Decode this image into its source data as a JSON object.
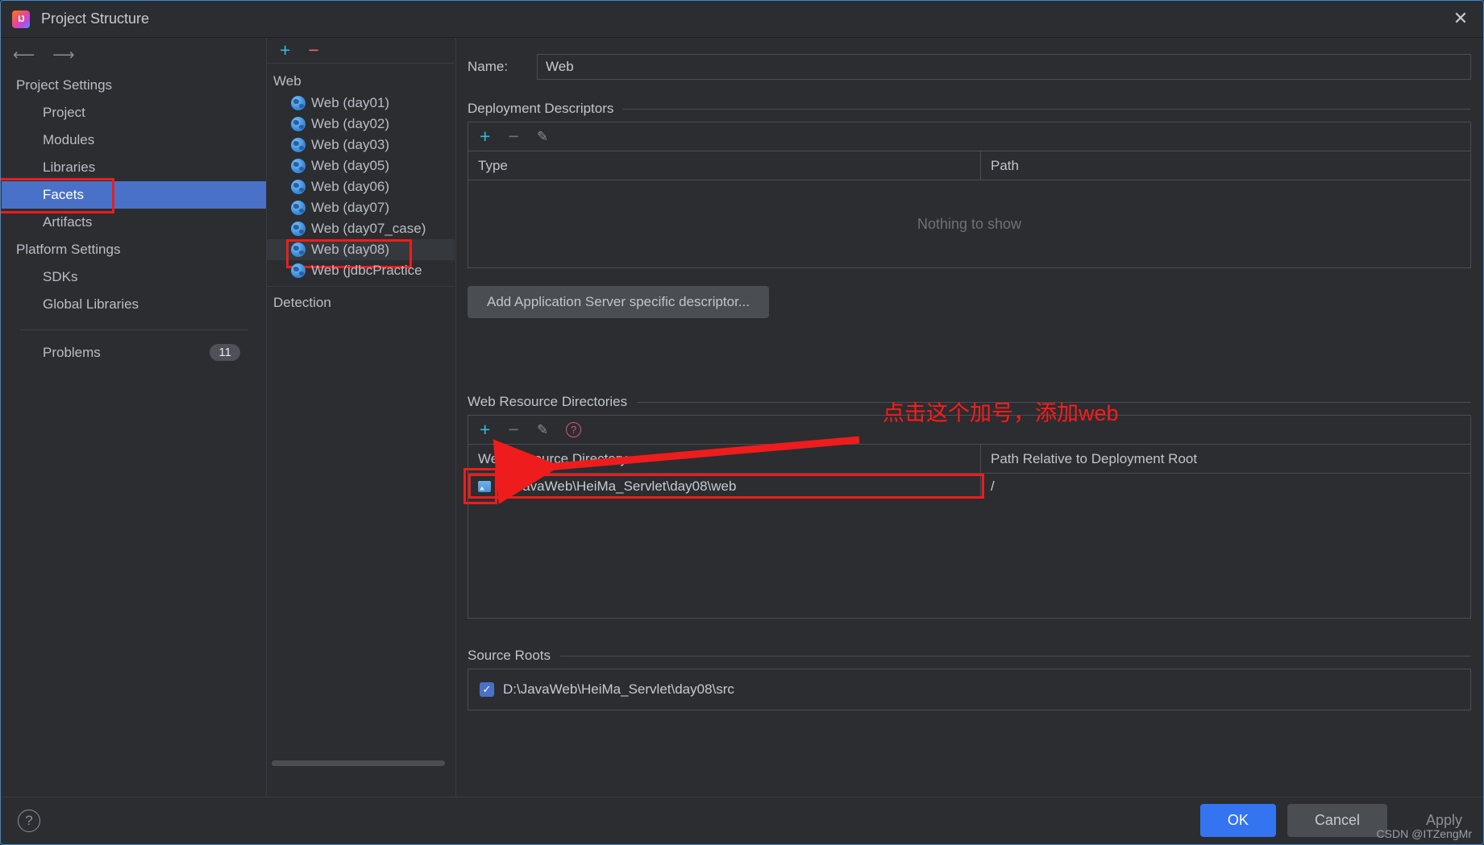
{
  "window": {
    "title": "Project Structure",
    "app_icon": "intellij-idea-icon",
    "close_icon": "close-icon"
  },
  "sidebar": {
    "back_icon": "arrow-left-icon",
    "forward_icon": "arrow-right-icon",
    "groups": [
      {
        "label": "Project Settings",
        "items": [
          {
            "label": "Project",
            "selected": false
          },
          {
            "label": "Modules",
            "selected": false
          },
          {
            "label": "Libraries",
            "selected": false
          },
          {
            "label": "Facets",
            "selected": true
          },
          {
            "label": "Artifacts",
            "selected": false
          }
        ]
      },
      {
        "label": "Platform Settings",
        "items": [
          {
            "label": "SDKs",
            "selected": false
          },
          {
            "label": "Global Libraries",
            "selected": false
          }
        ]
      }
    ],
    "problems": {
      "label": "Problems",
      "count": "11"
    }
  },
  "tree": {
    "toolbar": {
      "add_icon": "plus-icon",
      "remove_icon": "minus-icon"
    },
    "root": "Web",
    "items": [
      {
        "label": "Web (day01)",
        "selected": false
      },
      {
        "label": "Web (day02)",
        "selected": false
      },
      {
        "label": "Web (day03)",
        "selected": false
      },
      {
        "label": "Web (day05)",
        "selected": false
      },
      {
        "label": "Web (day06)",
        "selected": false
      },
      {
        "label": "Web (day07)",
        "selected": false
      },
      {
        "label": "Web (day07_case)",
        "selected": false
      },
      {
        "label": "Web (day08)",
        "selected": true
      },
      {
        "label": "Web (jdbcPractice",
        "selected": false
      }
    ],
    "detection_label": "Detection"
  },
  "content": {
    "name_label": "Name:",
    "name_value": "Web",
    "deployment": {
      "section_title": "Deployment Descriptors",
      "toolbar": {
        "add_icon": "plus-icon",
        "remove_icon": "minus-icon",
        "edit_icon": "pencil-icon"
      },
      "columns": [
        "Type",
        "Path"
      ],
      "empty_text": "Nothing to show",
      "add_button": "Add Application Server specific descriptor..."
    },
    "web_resources": {
      "section_title": "Web Resource Directories",
      "toolbar": {
        "add_icon": "plus-icon",
        "remove_icon": "minus-icon",
        "edit_icon": "pencil-icon",
        "help_icon": "question-mark-icon"
      },
      "columns": [
        "Web Resource Directory",
        "Path Relative to Deployment Root"
      ],
      "rows": [
        {
          "directory": "D:\\JavaWeb\\HeiMa_Servlet\\day08\\web",
          "relative_path": "/",
          "icon": "folder-icon"
        }
      ]
    },
    "source_roots": {
      "section_title": "Source Roots",
      "rows": [
        {
          "checked": true,
          "path": "D:\\JavaWeb\\HeiMa_Servlet\\day08\\src"
        }
      ]
    }
  },
  "annotation": {
    "text": "点击这个加号，添加web",
    "color": "#ff1a1a"
  },
  "footer": {
    "help_icon": "question-mark-icon",
    "ok": "OK",
    "cancel": "Cancel",
    "apply": "Apply",
    "watermark": "CSDN @ITZengMr"
  }
}
